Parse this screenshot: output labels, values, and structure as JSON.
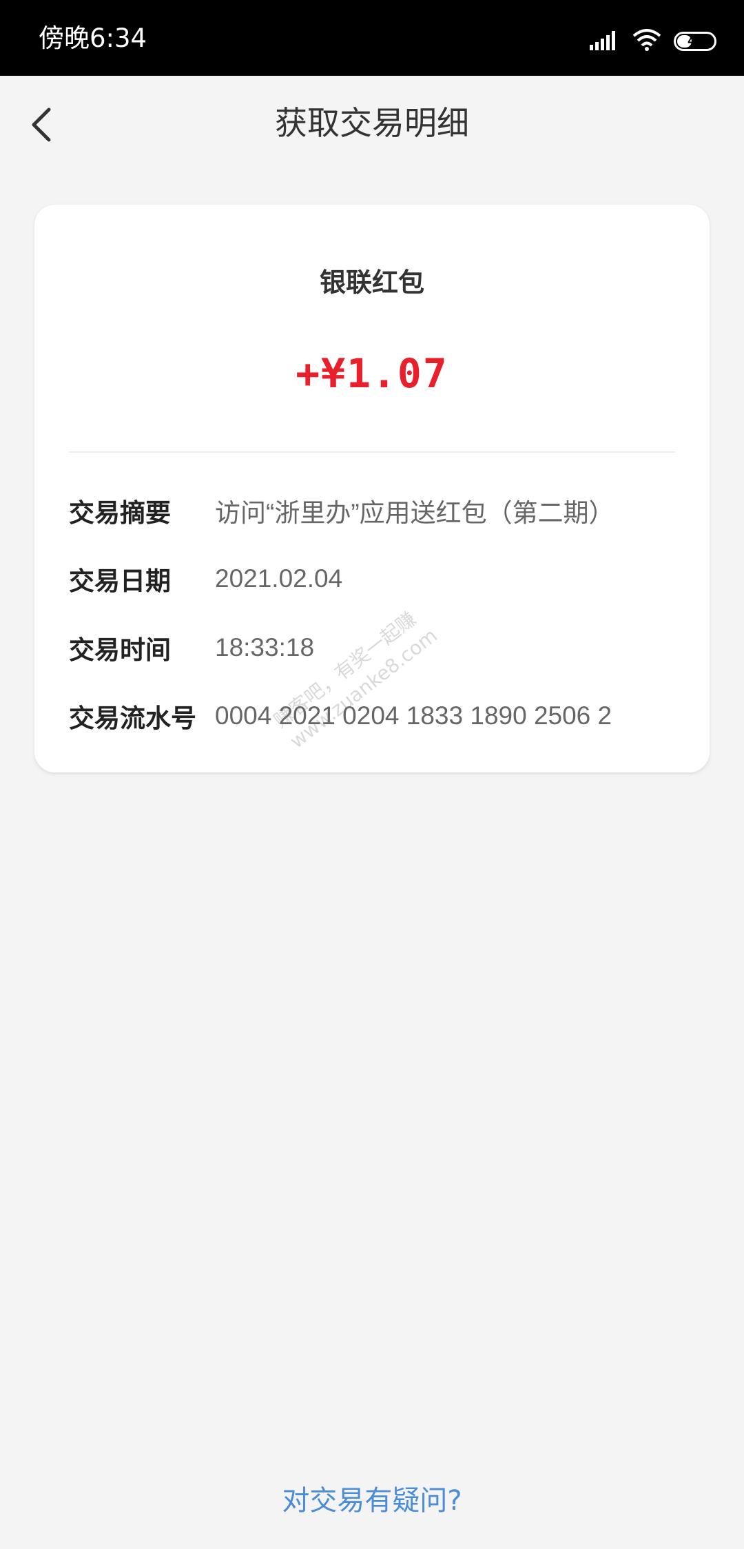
{
  "status_bar": {
    "time": "傍晚6:34",
    "battery": "41",
    "battery_level": 0.41,
    "icons": [
      "signal-icon",
      "wifi-icon",
      "battery-icon"
    ]
  },
  "header": {
    "title": "获取交易明细",
    "back_icon": "chevron-left-icon"
  },
  "transaction": {
    "title": "银联红包",
    "amount": "+¥1.07",
    "details": [
      {
        "label": "交易摘要",
        "value": "访问“浙里办”应用送红包（第二期）"
      },
      {
        "label": "交易日期",
        "value": "2021.02.04"
      },
      {
        "label": "交易时间",
        "value": "18:33:18"
      },
      {
        "label": "交易流水号",
        "value": "0004 2021 0204 1833 1890 2506 2"
      }
    ]
  },
  "watermark": {
    "line1": "赚客吧，有奖一起赚",
    "line2": "www.zuanke8.com"
  },
  "footer": {
    "help_link": "对交易有疑问?"
  },
  "colors": {
    "amount": "#e8202b",
    "link": "#4a8cd8",
    "background": "#f4f4f4"
  }
}
